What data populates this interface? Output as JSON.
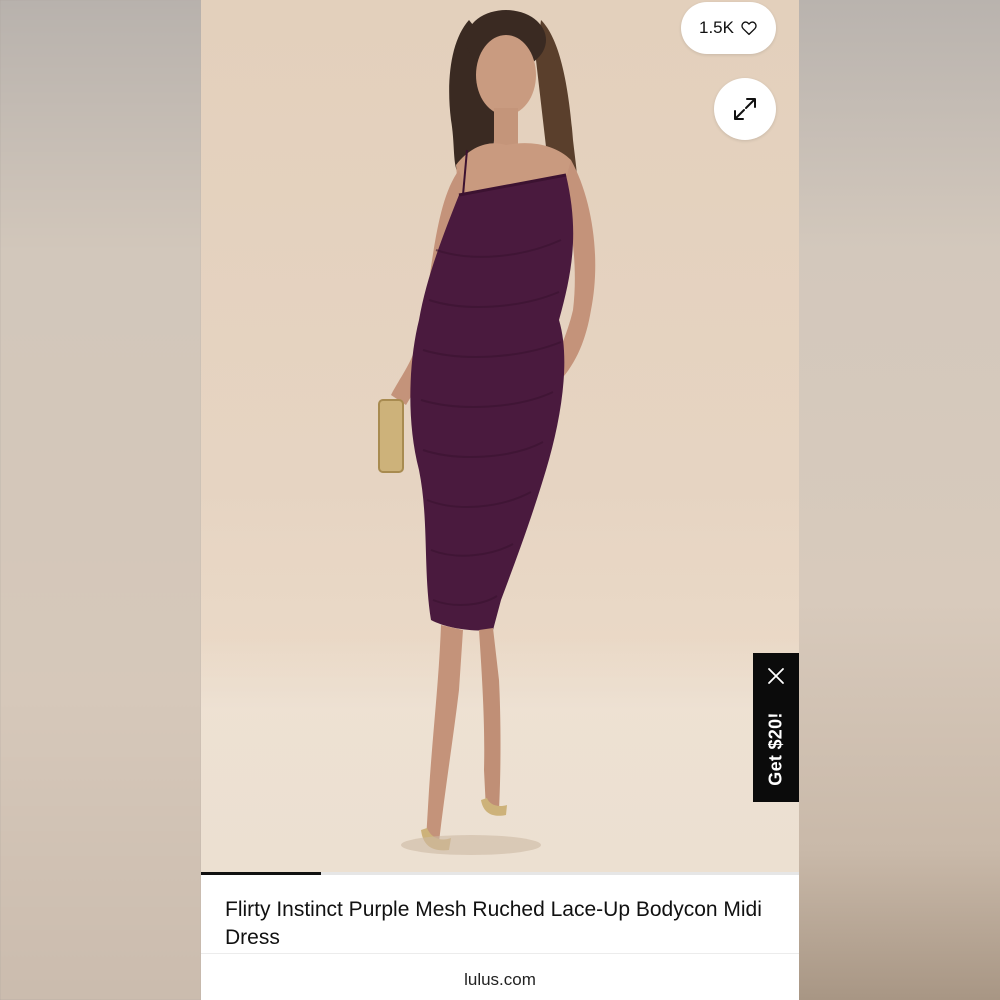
{
  "pin": {
    "like_count": "1.5K",
    "product_title": "Flirty Instinct Purple Mesh Ruched Lace-Up Bodycon Midi Dress",
    "source_domain": "lulus.com",
    "image_progress": 0.2
  },
  "promo": {
    "label": "Get $20!"
  },
  "icons": {
    "like": "heart-icon",
    "expand": "expand-icon",
    "close": "close-icon"
  },
  "colors": {
    "dress": "#4a1a3e",
    "backdrop": "#e5d3c0",
    "promo_bg": "#0b0b0b"
  }
}
